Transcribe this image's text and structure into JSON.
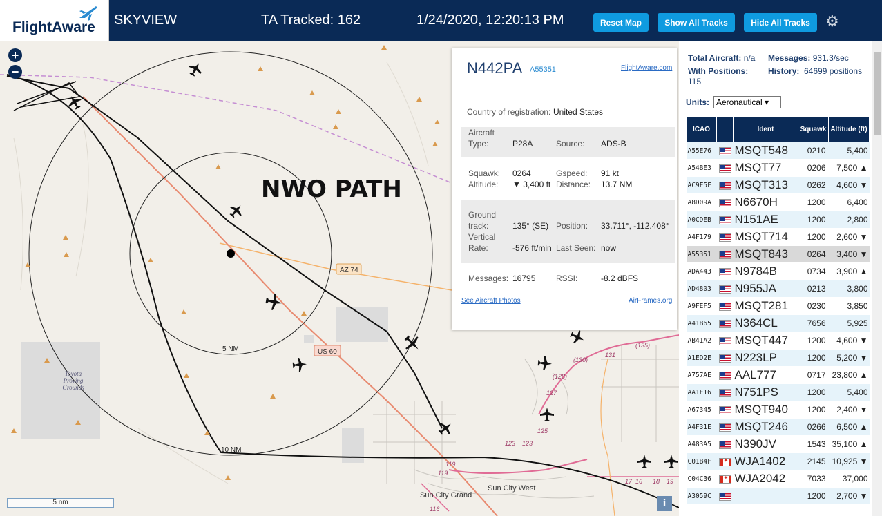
{
  "header": {
    "logo_text": "FlightAware",
    "title": "SKYVIEW",
    "tracked": "TA Tracked: 162",
    "datetime": "1/24/2020, 12:20:13 PM",
    "reset_map": "Reset Map",
    "show_all": "Show All Tracks",
    "hide_all": "Hide All Tracks",
    "settings_icon": "gear-icon"
  },
  "map": {
    "annotation": "NWO PATH",
    "ring_inner_label": "5 NM",
    "ring_outer_label": "10 NM",
    "road_az74": "AZ 74",
    "road_us60": "US 60",
    "place_toyota": "Toyota Proving Grounds",
    "place_sun_city_grand": "Sun City Grand",
    "place_sun_city_west": "Sun City West",
    "scale_label": "5 nm",
    "route_labels": [
      "(135)",
      "(130)",
      "131",
      "(128)",
      "127",
      "125",
      "123",
      "123",
      "119",
      "119",
      "116",
      "17",
      "16",
      "18",
      "19"
    ]
  },
  "popup": {
    "ident": "N442PA",
    "icao": "A55351",
    "flightaware_link": "FlightAware.com",
    "country_label": "Country of registration:",
    "country": "United States",
    "aircraft_type_label": "Aircraft Type:",
    "aircraft_type": "P28A",
    "source_label": "Source:",
    "source": "ADS-B",
    "squawk_label": "Squawk:",
    "squawk": "0264",
    "gspeed_label": "Gspeed:",
    "gspeed": "91 kt",
    "altitude_label": "Altitude:",
    "altitude": "▼ 3,400 ft",
    "distance_label": "Distance:",
    "distance": "13.7 NM",
    "track_label": "Ground track:",
    "track": "135° (SE)",
    "position_label": "Position:",
    "position": "33.711°, -112.408°",
    "vrate_label": "Vertical Rate:",
    "vrate": "-576 ft/min",
    "lastseen_label": "Last Seen:",
    "lastseen": "now",
    "messages_label": "Messages:",
    "messages": "16795",
    "rssi_label": "RSSI:",
    "rssi": "-8.2 dBFS",
    "photos_link": "See Aircraft Photos",
    "airframes_link": "AirFrames.org"
  },
  "panel": {
    "total_label": "Total Aircraft:",
    "total": "n/a",
    "messages_label": "Messages:",
    "messages": "931.3/sec",
    "withpos_label": "With Positions:",
    "withpos": "115",
    "history_label": "History:",
    "history": "64699 positions",
    "units_label": "Units:",
    "units_value": "Aeronautical ▾",
    "columns": [
      "ICAO",
      "",
      "Ident",
      "Squawk",
      "Altitude (ft)"
    ],
    "rows": [
      {
        "icao": "A55E76",
        "flag": "us",
        "ident": "MSQT548",
        "squawk": "0210",
        "alt": "5,400"
      },
      {
        "icao": "A54BE3",
        "flag": "us",
        "ident": "MSQT77",
        "squawk": "0206",
        "alt": "7,500 ▲"
      },
      {
        "icao": "AC9F5F",
        "flag": "us",
        "ident": "MSQT313",
        "squawk": "0262",
        "alt": "4,600 ▼"
      },
      {
        "icao": "A8D09A",
        "flag": "us",
        "ident": "N6670H",
        "squawk": "1200",
        "alt": "6,400"
      },
      {
        "icao": "A0CDEB",
        "flag": "us",
        "ident": "N151AE",
        "squawk": "1200",
        "alt": "2,800"
      },
      {
        "icao": "A4F179",
        "flag": "us",
        "ident": "MSQT714",
        "squawk": "1200",
        "alt": "2,600 ▼"
      },
      {
        "icao": "A55351",
        "flag": "us",
        "ident": "MSQT843",
        "squawk": "0264",
        "alt": "3,400 ▼"
      },
      {
        "icao": "ADA443",
        "flag": "us",
        "ident": "N9784B",
        "squawk": "0734",
        "alt": "3,900 ▲"
      },
      {
        "icao": "AD4803",
        "flag": "us",
        "ident": "N955JA",
        "squawk": "0213",
        "alt": "3,800"
      },
      {
        "icao": "A9FEF5",
        "flag": "us",
        "ident": "MSQT281",
        "squawk": "0230",
        "alt": "3,850"
      },
      {
        "icao": "A41B65",
        "flag": "us",
        "ident": "N364CL",
        "squawk": "7656",
        "alt": "5,925"
      },
      {
        "icao": "AB41A2",
        "flag": "us",
        "ident": "MSQT447",
        "squawk": "1200",
        "alt": "4,600 ▼"
      },
      {
        "icao": "A1ED2E",
        "flag": "us",
        "ident": "N223LP",
        "squawk": "1200",
        "alt": "5,200 ▼"
      },
      {
        "icao": "A757AE",
        "flag": "us",
        "ident": "AAL777",
        "squawk": "0717",
        "alt": "23,800 ▲"
      },
      {
        "icao": "AA1F16",
        "flag": "us",
        "ident": "N751PS",
        "squawk": "1200",
        "alt": "5,400"
      },
      {
        "icao": "A67345",
        "flag": "us",
        "ident": "MSQT940",
        "squawk": "1200",
        "alt": "2,400 ▼"
      },
      {
        "icao": "A4F31E",
        "flag": "us",
        "ident": "MSQT246",
        "squawk": "0266",
        "alt": "6,500 ▲"
      },
      {
        "icao": "A483A5",
        "flag": "us",
        "ident": "N390JV",
        "squawk": "1543",
        "alt": "35,100 ▲"
      },
      {
        "icao": "C01B4F",
        "flag": "ca",
        "ident": "WJA1402",
        "squawk": "2145",
        "alt": "10,925 ▼"
      },
      {
        "icao": "C04C36",
        "flag": "ca",
        "ident": "WJA2042",
        "squawk": "7033",
        "alt": "37,000"
      },
      {
        "icao": "A3059C",
        "flag": "us",
        "ident": "",
        "squawk": "1200",
        "alt": "2,700 ▼"
      }
    ],
    "selected_icao": "A55351"
  }
}
